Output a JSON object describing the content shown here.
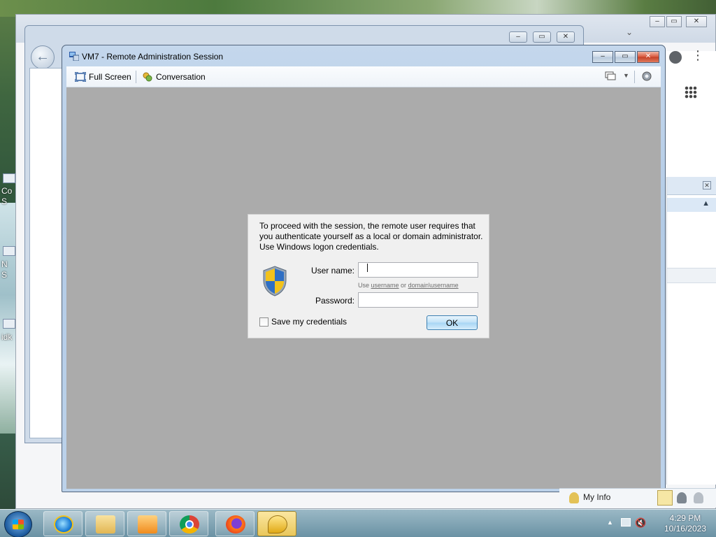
{
  "desktop": {
    "label_fragments": [
      "Co",
      "S",
      "N",
      "S",
      "idk"
    ]
  },
  "browser": {
    "window_controls": [
      "–",
      "▭",
      "✕"
    ]
  },
  "vm_window": {
    "title": "VM7 - Remote Administration Session",
    "toolbar": {
      "full_screen_label": "Full Screen",
      "conversation_label": "Conversation"
    }
  },
  "auth_dialog": {
    "message": "To proceed with the session, the remote user requires that you authenticate yourself as a local or domain administrator. Use Windows logon credentials.",
    "username_label": "User name:",
    "username_value": "",
    "username_hint_prefix": "Use ",
    "username_hint_a": "username",
    "username_hint_mid": " or ",
    "username_hint_b": "domain\\username",
    "password_label": "Password:",
    "password_value": "",
    "save_credentials_label": "Save my credentials",
    "save_credentials_checked": false,
    "ok_label": "OK"
  },
  "lync": {
    "my_info_label": "My Info"
  },
  "taskbar": {
    "apps": [
      "internet-explorer",
      "file-explorer",
      "media-player",
      "chrome",
      "firefox",
      "lync"
    ],
    "clock_time": "4:29 PM",
    "clock_date": "10/16/2023"
  },
  "colors": {
    "remote_desktop_bg": "#ababab",
    "ok_button_border": "#3c7fb1",
    "close_button": "#c43f26"
  }
}
